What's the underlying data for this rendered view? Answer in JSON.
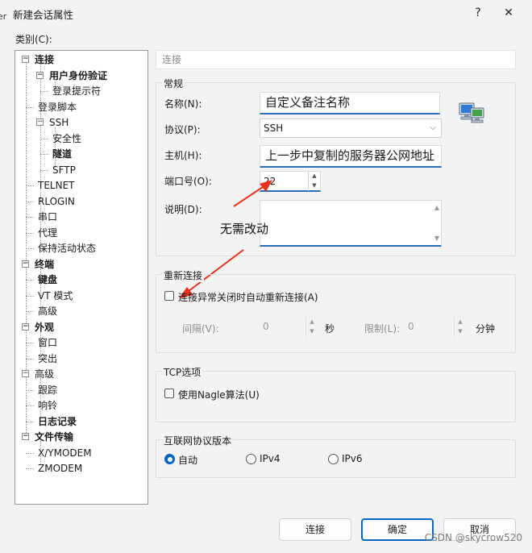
{
  "window": {
    "title": "新建会话属性",
    "help_glyph": "?",
    "close_glyph": "✕",
    "edge_glyph": "er"
  },
  "category_label": "类别(C):",
  "tree": [
    {
      "label": "连接",
      "bold": true
    },
    {
      "label": "用户身份验证",
      "bold": true
    },
    {
      "label": "登录提示符",
      "bold": false
    },
    {
      "label": "登录脚本",
      "bold": false
    },
    {
      "label": "SSH",
      "bold": false
    },
    {
      "label": "安全性",
      "bold": false
    },
    {
      "label": "隧道",
      "bold": true
    },
    {
      "label": "SFTP",
      "bold": false
    },
    {
      "label": "TELNET",
      "bold": false
    },
    {
      "label": "RLOGIN",
      "bold": false
    },
    {
      "label": "串口",
      "bold": false
    },
    {
      "label": "代理",
      "bold": false
    },
    {
      "label": "保持活动状态",
      "bold": false
    },
    {
      "label": "终端",
      "bold": true
    },
    {
      "label": "键盘",
      "bold": true
    },
    {
      "label": "VT 模式",
      "bold": false
    },
    {
      "label": "高级",
      "bold": false
    },
    {
      "label": "外观",
      "bold": true
    },
    {
      "label": "窗口",
      "bold": false
    },
    {
      "label": "突出",
      "bold": false
    },
    {
      "label": "高级",
      "bold": false
    },
    {
      "label": "跟踪",
      "bold": false
    },
    {
      "label": "响铃",
      "bold": false
    },
    {
      "label": "日志记录",
      "bold": true
    },
    {
      "label": "文件传输",
      "bold": true
    },
    {
      "label": "X/YMODEM",
      "bold": false
    },
    {
      "label": "ZMODEM",
      "bold": false
    }
  ],
  "breadcrumb": "连接",
  "general": {
    "legend": "常规",
    "name_label": "名称(N):",
    "name_value": "自定义备注名称",
    "protocol_label": "协议(P):",
    "protocol_value": "SSH",
    "host_label": "主机(H):",
    "host_value": "上一步中复制的服务器公网地址",
    "port_label": "端口号(O):",
    "port_value": "22",
    "desc_label": "说明(D):",
    "desc_value": ""
  },
  "annotation": "无需改动",
  "reconnect": {
    "legend": "重新连接",
    "checkbox_label": "连接异常关闭时自动重新连接(A)",
    "interval_label": "间隔(V):",
    "interval_value": "0",
    "interval_unit": "秒",
    "limit_label": "限制(L):",
    "limit_value": "0",
    "limit_unit": "分钟"
  },
  "tcp": {
    "legend": "TCP选项",
    "nagle_label": "使用Nagle算法(U)"
  },
  "ip": {
    "legend": "互联网协议版本",
    "options": [
      "自动",
      "IPv4",
      "IPv6"
    ],
    "selected": "自动"
  },
  "buttons": {
    "connect": "连接",
    "ok": "确定",
    "cancel": "取消"
  },
  "watermark": "CSDN @skycrow520",
  "colors": {
    "accent": "#0067c0",
    "arrow": "#e8321e"
  }
}
